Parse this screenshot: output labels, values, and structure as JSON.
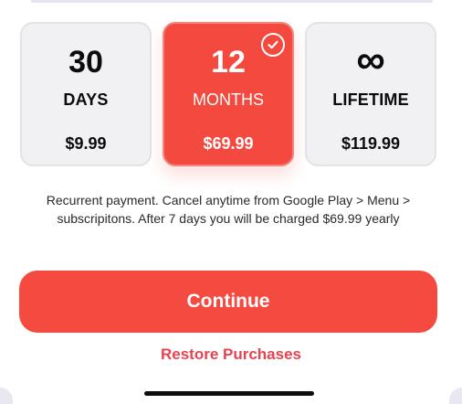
{
  "plans": [
    {
      "value": "30",
      "unit": "DAYS",
      "price": "$9.99",
      "selected": false
    },
    {
      "value": "12",
      "unit": "MONTHS",
      "price": "$69.99",
      "selected": true
    },
    {
      "value": "∞",
      "unit": "LIFETIME",
      "price": "$119.99",
      "selected": false
    }
  ],
  "disclaimer": "Recurrent payment. Cancel anytime from Google Play > Menu > subscripitons. After 7 days you will be charged $69.99 yearly",
  "continue_label": "Continue",
  "restore_label": "Restore Purchases",
  "icons": {
    "selected_check": "check-circle-icon"
  },
  "colors": {
    "accent": "#f44a40",
    "restore_text": "#e8424f",
    "card_bg": "#f1f1f4"
  }
}
